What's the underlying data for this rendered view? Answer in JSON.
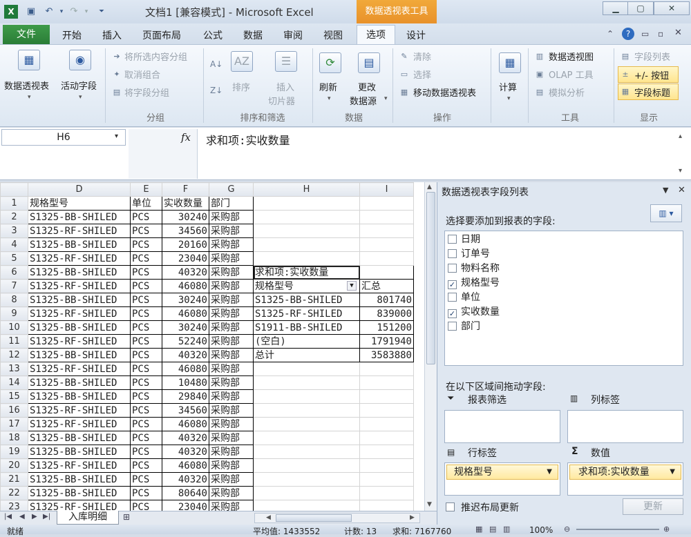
{
  "window": {
    "title": "文档1 [兼容模式] - Microsoft Excel",
    "context_tab_title": "数据透视表工具"
  },
  "tabs": [
    "文件",
    "开始",
    "插入",
    "页面布局",
    "公式",
    "数据",
    "审阅",
    "视图",
    "选项",
    "设计"
  ],
  "ribbon": {
    "pivot_table": "数据透视表",
    "active_field": "活动字段",
    "group_selection": "将所选内容分组",
    "ungroup": "取消组合",
    "group_field": "将字段分组",
    "group_label": "分组",
    "sort": "排序",
    "insert_slicer_1": "插入",
    "insert_slicer_2": "切片器",
    "sort_filter_label": "排序和筛选",
    "refresh": "刷新",
    "change_source_1": "更改",
    "change_source_2": "数据源",
    "data_label": "数据",
    "clear": "清除",
    "select": "选择",
    "move_pivot": "移动数据透视表",
    "actions_label": "操作",
    "calculate": "计算",
    "pivot_chart": "数据透视图",
    "olap_tools": "OLAP 工具",
    "what_if": "模拟分析",
    "tools_label": "工具",
    "field_list": "字段列表",
    "buttons": "+/- 按钮",
    "field_headers": "字段标题",
    "show_label": "显示"
  },
  "formula_bar": {
    "name_box": "H6",
    "fx": "fx",
    "formula": "求和项:实收数量"
  },
  "grid": {
    "columns": [
      "D",
      "E",
      "F",
      "G",
      "H",
      "I"
    ],
    "rows": [
      {
        "n": "1",
        "d": "规格型号",
        "e": "单位",
        "f": "实收数量",
        "g": "部门",
        "h": "",
        "i": ""
      },
      {
        "n": "2",
        "d": "S1325-BB-SHILED",
        "e": "PCS",
        "f": "30240",
        "g": "采购部",
        "h": "",
        "i": ""
      },
      {
        "n": "3",
        "d": "S1325-RF-SHILED",
        "e": "PCS",
        "f": "34560",
        "g": "采购部",
        "h": "",
        "i": ""
      },
      {
        "n": "4",
        "d": "S1325-BB-SHILED",
        "e": "PCS",
        "f": "20160",
        "g": "采购部",
        "h": "",
        "i": ""
      },
      {
        "n": "5",
        "d": "S1325-RF-SHILED",
        "e": "PCS",
        "f": "23040",
        "g": "采购部",
        "h": "",
        "i": ""
      },
      {
        "n": "6",
        "d": "S1325-BB-SHILED",
        "e": "PCS",
        "f": "40320",
        "g": "采购部",
        "h": "求和项:实收数量",
        "i": ""
      },
      {
        "n": "7",
        "d": "S1325-RF-SHILED",
        "e": "PCS",
        "f": "46080",
        "g": "采购部",
        "h": "规格型号",
        "i": "汇总"
      },
      {
        "n": "8",
        "d": "S1325-BB-SHILED",
        "e": "PCS",
        "f": "30240",
        "g": "采购部",
        "h": "S1325-BB-SHILED",
        "i": "801740"
      },
      {
        "n": "9",
        "d": "S1325-RF-SHILED",
        "e": "PCS",
        "f": "46080",
        "g": "采购部",
        "h": "S1325-RF-SHILED",
        "i": "839000"
      },
      {
        "n": "10",
        "d": "S1325-BB-SHILED",
        "e": "PCS",
        "f": "30240",
        "g": "采购部",
        "h": "S1911-BB-SHILED",
        "i": "151200"
      },
      {
        "n": "11",
        "d": "S1325-RF-SHILED",
        "e": "PCS",
        "f": "52240",
        "g": "采购部",
        "h": "(空白)",
        "i": "1791940"
      },
      {
        "n": "12",
        "d": "S1325-BB-SHILED",
        "e": "PCS",
        "f": "40320",
        "g": "采购部",
        "h": "总计",
        "i": "3583880"
      },
      {
        "n": "13",
        "d": "S1325-RF-SHILED",
        "e": "PCS",
        "f": "46080",
        "g": "采购部",
        "h": "",
        "i": ""
      },
      {
        "n": "14",
        "d": "S1325-BB-SHILED",
        "e": "PCS",
        "f": "10480",
        "g": "采购部",
        "h": "",
        "i": ""
      },
      {
        "n": "15",
        "d": "S1325-BB-SHILED",
        "e": "PCS",
        "f": "29840",
        "g": "采购部",
        "h": "",
        "i": ""
      },
      {
        "n": "16",
        "d": "S1325-RF-SHILED",
        "e": "PCS",
        "f": "34560",
        "g": "采购部",
        "h": "",
        "i": ""
      },
      {
        "n": "17",
        "d": "S1325-RF-SHILED",
        "e": "PCS",
        "f": "46080",
        "g": "采购部",
        "h": "",
        "i": ""
      },
      {
        "n": "18",
        "d": "S1325-BB-SHILED",
        "e": "PCS",
        "f": "40320",
        "g": "采购部",
        "h": "",
        "i": ""
      },
      {
        "n": "19",
        "d": "S1325-BB-SHILED",
        "e": "PCS",
        "f": "40320",
        "g": "采购部",
        "h": "",
        "i": ""
      },
      {
        "n": "20",
        "d": "S1325-RF-SHILED",
        "e": "PCS",
        "f": "46080",
        "g": "采购部",
        "h": "",
        "i": ""
      },
      {
        "n": "21",
        "d": "S1325-BB-SHILED",
        "e": "PCS",
        "f": "40320",
        "g": "采购部",
        "h": "",
        "i": ""
      },
      {
        "n": "22",
        "d": "S1325-BB-SHILED",
        "e": "PCS",
        "f": "80640",
        "g": "采购部",
        "h": "",
        "i": ""
      },
      {
        "n": "23",
        "d": "S1325-RF-SHILED",
        "e": "PCS",
        "f": "23040",
        "g": "采购部",
        "h": "",
        "i": ""
      }
    ]
  },
  "sheet_tab": "入库明细",
  "status": {
    "ready": "就绪",
    "average": "平均值: 1433552",
    "count": "计数: 13",
    "sum": "求和: 7167760",
    "zoom": "100%"
  },
  "pane": {
    "title": "数据透视表字段列表",
    "choose_label": "选择要添加到报表的字段:",
    "fields": [
      {
        "label": "日期",
        "checked": ""
      },
      {
        "label": "订单号",
        "checked": ""
      },
      {
        "label": "物料名称",
        "checked": ""
      },
      {
        "label": "规格型号",
        "checked": "✓"
      },
      {
        "label": "单位",
        "checked": ""
      },
      {
        "label": "实收数量",
        "checked": "✓"
      },
      {
        "label": "部门",
        "checked": ""
      }
    ],
    "drag_label": "在以下区域间拖动字段:",
    "report_filter": "报表筛选",
    "column_labels": "列标签",
    "row_labels": "行标签",
    "values": "数值",
    "row_item": "规格型号",
    "value_item": "求和项:实收数量",
    "defer_update": "推迟布局更新",
    "update": "更新"
  }
}
